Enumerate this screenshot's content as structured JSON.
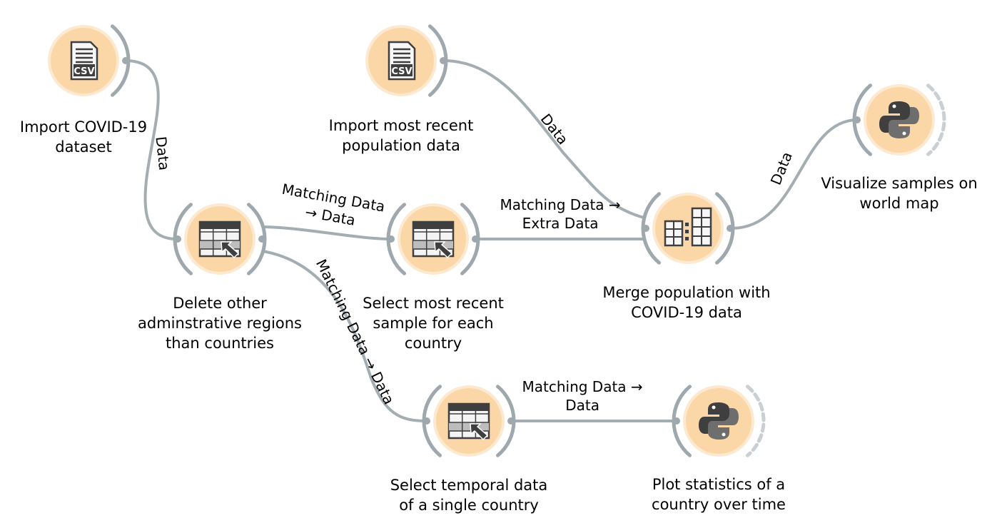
{
  "colors": {
    "node_fill": "#fbd7a8",
    "node_halo": "#fde9cf",
    "bracket": "#9ea8ad",
    "bracket_dashed": "#c9cfd2",
    "link": "#a3adb2",
    "icon": "#3f3f3f"
  },
  "nodes": [
    {
      "id": "import_covid",
      "icon": "csv-file-icon",
      "caption": "Import COVID-19\ndataset"
    },
    {
      "id": "import_population",
      "icon": "csv-file-icon",
      "caption": "Import most recent\npopulation data"
    },
    {
      "id": "delete_regions",
      "icon": "select-rows-icon",
      "caption": "Delete other\nadminstrative regions\nthan countries"
    },
    {
      "id": "select_recent",
      "icon": "select-rows-icon",
      "caption": "Select most recent\nsample for each\ncountry"
    },
    {
      "id": "merge",
      "icon": "merge-data-icon",
      "caption": "Merge population with\nCOVID-19 data"
    },
    {
      "id": "visualize_map",
      "icon": "python-script-icon",
      "caption": "Visualize samples on\nworld map"
    },
    {
      "id": "select_temporal",
      "icon": "select-rows-icon",
      "caption": "Select temporal data\nof a single country"
    },
    {
      "id": "plot_stats",
      "icon": "python-script-icon",
      "caption": "Plot statistics of a\ncountry over time"
    }
  ],
  "links": [
    {
      "from": "import_covid",
      "to": "delete_regions",
      "label": "Data"
    },
    {
      "from": "delete_regions",
      "to": "select_recent",
      "label": "Matching Data\n→ Data"
    },
    {
      "from": "import_population",
      "to": "merge",
      "label": "Data"
    },
    {
      "from": "select_recent",
      "to": "merge",
      "label": "Matching Data →\nExtra Data"
    },
    {
      "from": "merge",
      "to": "visualize_map",
      "label": "Data"
    },
    {
      "from": "delete_regions",
      "to": "select_temporal",
      "label": "Matching Data → Data"
    },
    {
      "from": "select_temporal",
      "to": "plot_stats",
      "label": "Matching Data →\nData"
    }
  ]
}
